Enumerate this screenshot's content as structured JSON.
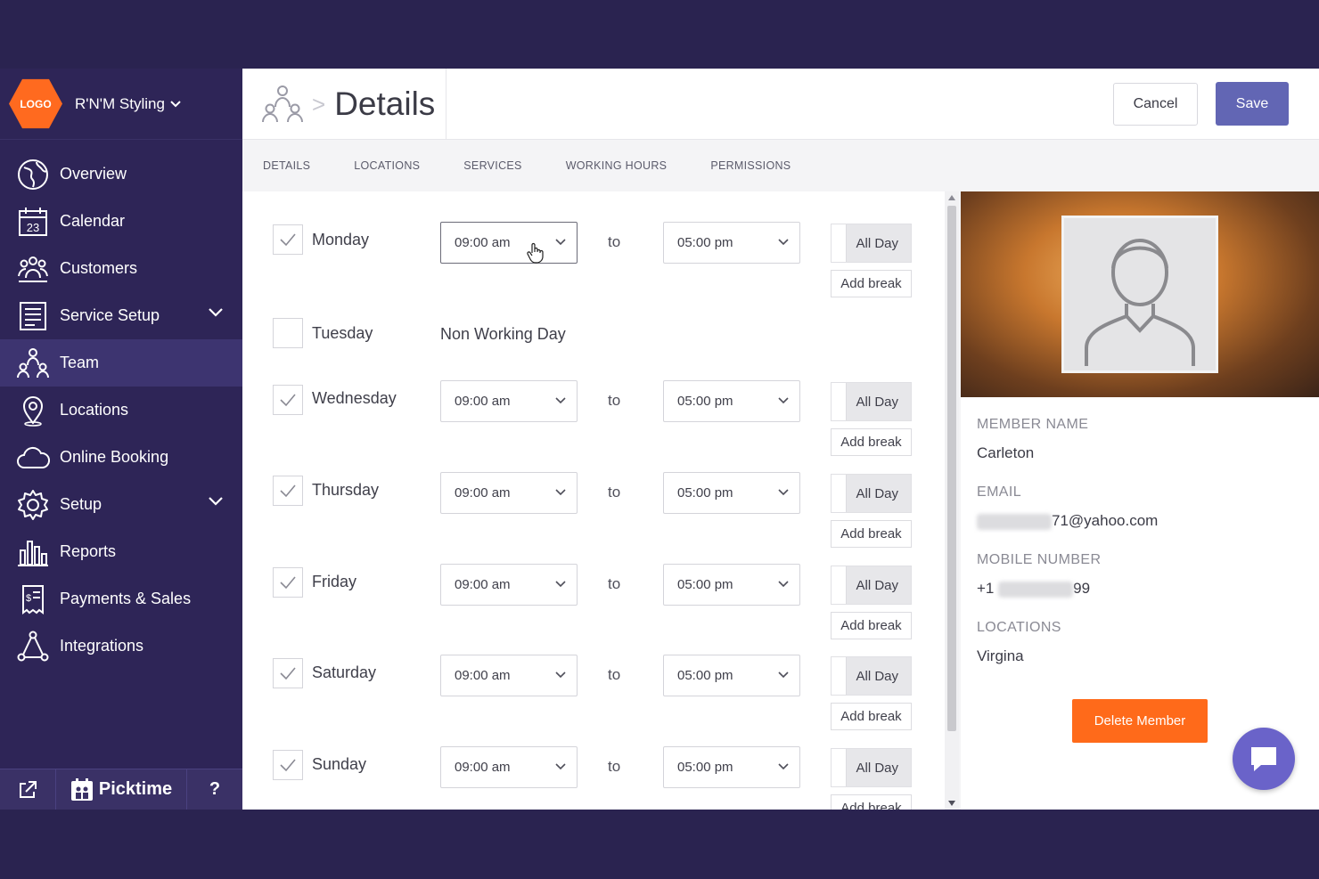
{
  "brand": {
    "logo_text": "LOGO",
    "business_name": "R'N'M Styling"
  },
  "sidebar": {
    "items": [
      {
        "label": "Overview",
        "icon": "globe-icon"
      },
      {
        "label": "Calendar",
        "icon": "calendar-icon",
        "badge": "23"
      },
      {
        "label": "Customers",
        "icon": "customers-icon"
      },
      {
        "label": "Service Setup",
        "icon": "service-list-icon"
      },
      {
        "label": "Team",
        "icon": "team-icon",
        "active": true
      },
      {
        "label": "Locations",
        "icon": "location-pin-icon"
      },
      {
        "label": "Online Booking",
        "icon": "cloud-icon"
      },
      {
        "label": "Setup",
        "icon": "gear-icon"
      },
      {
        "label": "Reports",
        "icon": "bar-chart-icon"
      },
      {
        "label": "Payments & Sales",
        "icon": "receipt-icon"
      },
      {
        "label": "Integrations",
        "icon": "integrations-icon"
      }
    ],
    "footer": {
      "brand": "Picktime",
      "help": "?"
    }
  },
  "header": {
    "title": "Details",
    "separator": ">",
    "cancel_label": "Cancel",
    "save_label": "Save"
  },
  "tabs": [
    "DETAILS",
    "LOCATIONS",
    "SERVICES",
    "WORKING HOURS",
    "PERMISSIONS"
  ],
  "schedule": {
    "to_label": "to",
    "all_day_label": "All Day",
    "add_break_label": "Add break",
    "non_working_label": "Non Working Day",
    "days": [
      {
        "name": "Monday",
        "checked": true,
        "start": "09:00 am",
        "end": "05:00 pm"
      },
      {
        "name": "Tuesday",
        "checked": false
      },
      {
        "name": "Wednesday",
        "checked": true,
        "start": "09:00 am",
        "end": "05:00 pm"
      },
      {
        "name": "Thursday",
        "checked": true,
        "start": "09:00 am",
        "end": "05:00 pm"
      },
      {
        "name": "Friday",
        "checked": true,
        "start": "09:00 am",
        "end": "05:00 pm"
      },
      {
        "name": "Saturday",
        "checked": true,
        "start": "09:00 am",
        "end": "05:00 pm"
      },
      {
        "name": "Sunday",
        "checked": true,
        "start": "09:00 am",
        "end": "05:00 pm"
      }
    ]
  },
  "profile": {
    "member_name_label": "MEMBER NAME",
    "member_name": "Carleton",
    "email_label": "EMAIL",
    "email_visible": "71@yahoo.com",
    "mobile_label": "MOBILE NUMBER",
    "mobile_prefix": "+1",
    "mobile_suffix": "99",
    "locations_label": "LOCATIONS",
    "location": "Virgina",
    "delete_label": "Delete Member"
  },
  "colors": {
    "sidebar": "#2e2557",
    "accent": "#6266b4",
    "danger": "#ff6a1a",
    "logo": "#ff6a1f"
  }
}
